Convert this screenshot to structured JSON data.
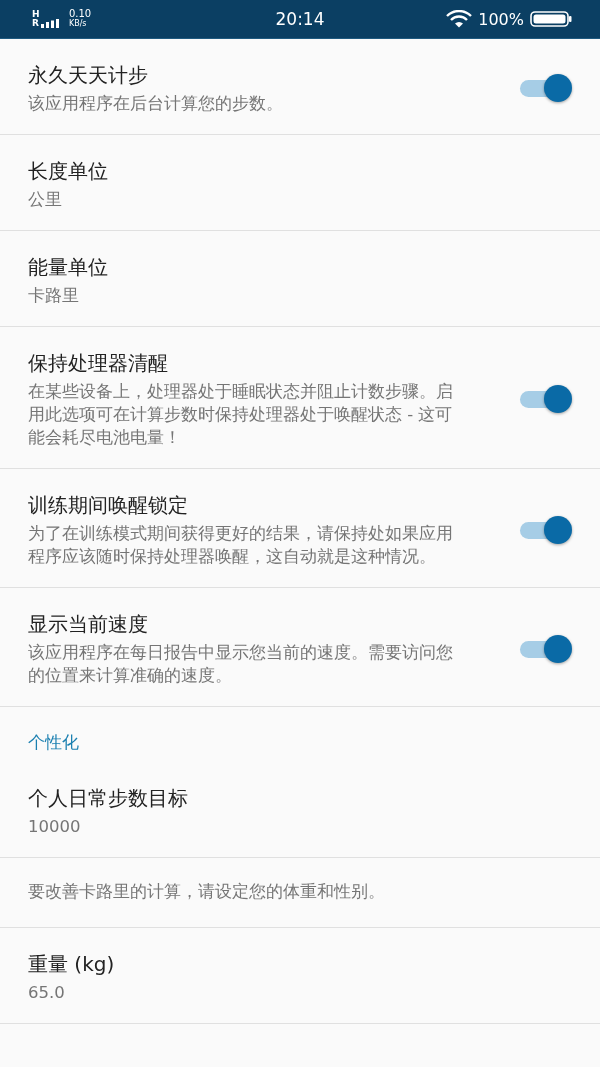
{
  "status_bar": {
    "network_top": "H",
    "network_bottom": "R",
    "speed": "0.10",
    "speed_unit": "KB/s",
    "time": "20:14",
    "battery": "100%"
  },
  "settings": [
    {
      "kind": "switch",
      "title": "永久天天计步",
      "summary": "该应用程序在后台计算您的步数。",
      "checked": true
    },
    {
      "kind": "value",
      "title": "长度单位",
      "summary": "公里"
    },
    {
      "kind": "value",
      "title": "能量单位",
      "summary": "卡路里"
    },
    {
      "kind": "switch",
      "title": "保持处理器清醒",
      "summary": "在某些设备上，处理器处于睡眠状态并阻止计数步骤。启用此选项可在计算步数时保持处理器处于唤醒状态 - 这可能会耗尽电池电量！",
      "checked": true
    },
    {
      "kind": "switch",
      "title": "训练期间唤醒锁定",
      "summary": "为了在训练模式期间获得更好的结果，请保持处如果应用程序应该随时保持处理器唤醒，这自动就是这种情况。",
      "checked": true
    },
    {
      "kind": "switch",
      "title": "显示当前速度",
      "summary": "该应用程序在每日报告中显示您当前的速度。需要访问您的位置来计算准确的速度。",
      "checked": true
    },
    {
      "kind": "category",
      "title": "个性化"
    },
    {
      "kind": "value",
      "title": "个人日常步数目标",
      "summary": "10000"
    },
    {
      "kind": "info",
      "summary": "要改善卡路里的计算，请设定您的体重和性别。"
    },
    {
      "kind": "value",
      "title": "重量 (kg)",
      "summary": "65.0"
    }
  ]
}
